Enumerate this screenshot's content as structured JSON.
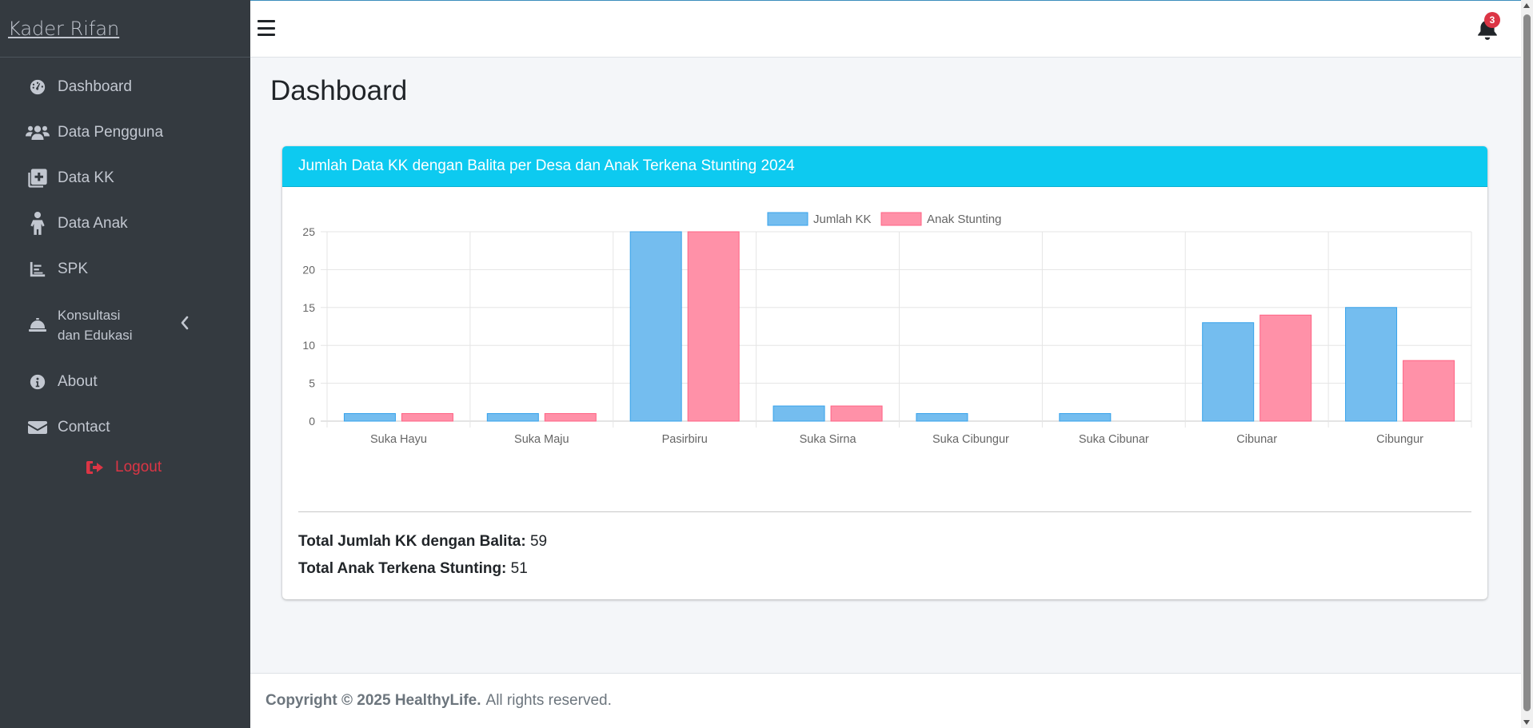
{
  "sidebar": {
    "brand": "Kader Rifan",
    "items": [
      {
        "label": "Dashboard",
        "icon": "dashboard-gauge-icon"
      },
      {
        "label": "Data Pengguna",
        "icon": "users-icon"
      },
      {
        "label": "Data KK",
        "icon": "add-document-icon"
      },
      {
        "label": "Data Anak",
        "icon": "child-icon"
      },
      {
        "label": "SPK",
        "icon": "chart-icon"
      },
      {
        "label": "Konsultasi dan Edukasi",
        "line1": "Konsultasi",
        "line2": "dan Edukasi",
        "icon": "concierge-bell-icon"
      },
      {
        "label": "About",
        "icon": "info-icon"
      },
      {
        "label": "Contact",
        "icon": "envelope-icon"
      }
    ],
    "logout": "Logout"
  },
  "topbar": {
    "notification_count": "3"
  },
  "page": {
    "title": "Dashboard"
  },
  "card": {
    "header": "Jumlah Data KK dengan Balita per Desa dan Anak Terkena Stunting 2024",
    "total_kk_label": "Total Jumlah KK dengan Balita:",
    "total_kk_value": "59",
    "total_stunting_label": "Total Anak Terkena Stunting:",
    "total_stunting_value": "51"
  },
  "chart_data": {
    "type": "bar",
    "categories": [
      "Suka Hayu",
      "Suka Maju",
      "Pasirbiru",
      "Suka Sirna",
      "Suka Cibungur",
      "Suka Cibunar",
      "Cibunar",
      "Cibungur"
    ],
    "series": [
      {
        "name": "Jumlah KK",
        "values": [
          1,
          1,
          25,
          2,
          1,
          1,
          13,
          15
        ],
        "color": "#74bdef",
        "border": "#36a2eb"
      },
      {
        "name": "Anak Stunting",
        "values": [
          1,
          1,
          25,
          2,
          0,
          0,
          14,
          8
        ],
        "color": "#ff91a8",
        "border": "#ff6384"
      }
    ],
    "ylim": [
      0,
      25
    ],
    "yticks": [
      0,
      5,
      10,
      15,
      20,
      25
    ],
    "grid": true,
    "legend": "top"
  },
  "footer": {
    "copyright": "Copyright © 2025 HealthyLife.",
    "rights": "All rights reserved."
  }
}
